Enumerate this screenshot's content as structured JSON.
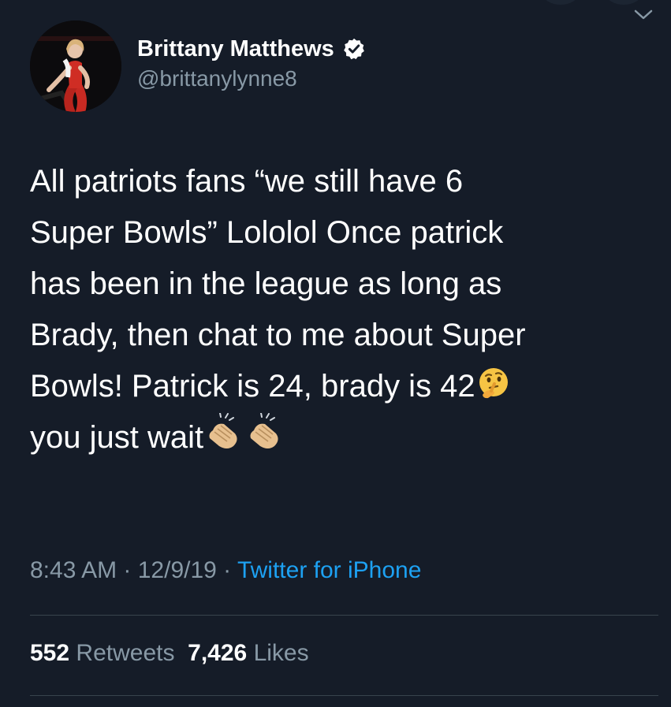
{
  "user": {
    "display_name": "Brittany Matthews",
    "handle": "@brittanylynne8",
    "verified": true,
    "avatar_icon": "profile-photo"
  },
  "tweet": {
    "lines": [
      "All patriots fans “we still have 6",
      "Super Bowls” Lololol Once patrick",
      "has been in the league as long as",
      "Brady, then chat to me about Super",
      "Bowls! Patrick is 24, brady is 42",
      "you just wait"
    ],
    "emojis": {
      "line5": "thinking-face-emoji",
      "line6": [
        "clapping-hands-emoji",
        "clapping-hands-emoji"
      ]
    }
  },
  "meta": {
    "time": "8:43 AM",
    "sep1": " · ",
    "date": "12/9/19",
    "sep2": " · ",
    "source": "Twitter for iPhone"
  },
  "stats": {
    "retweets_count": "552",
    "retweets_label": "Retweets",
    "likes_count": "7,426",
    "likes_label": "Likes"
  },
  "colors": {
    "background": "#151c28",
    "text": "#ffffff",
    "muted": "#8899a6",
    "link": "#1da1f2",
    "divider": "#38444d"
  }
}
